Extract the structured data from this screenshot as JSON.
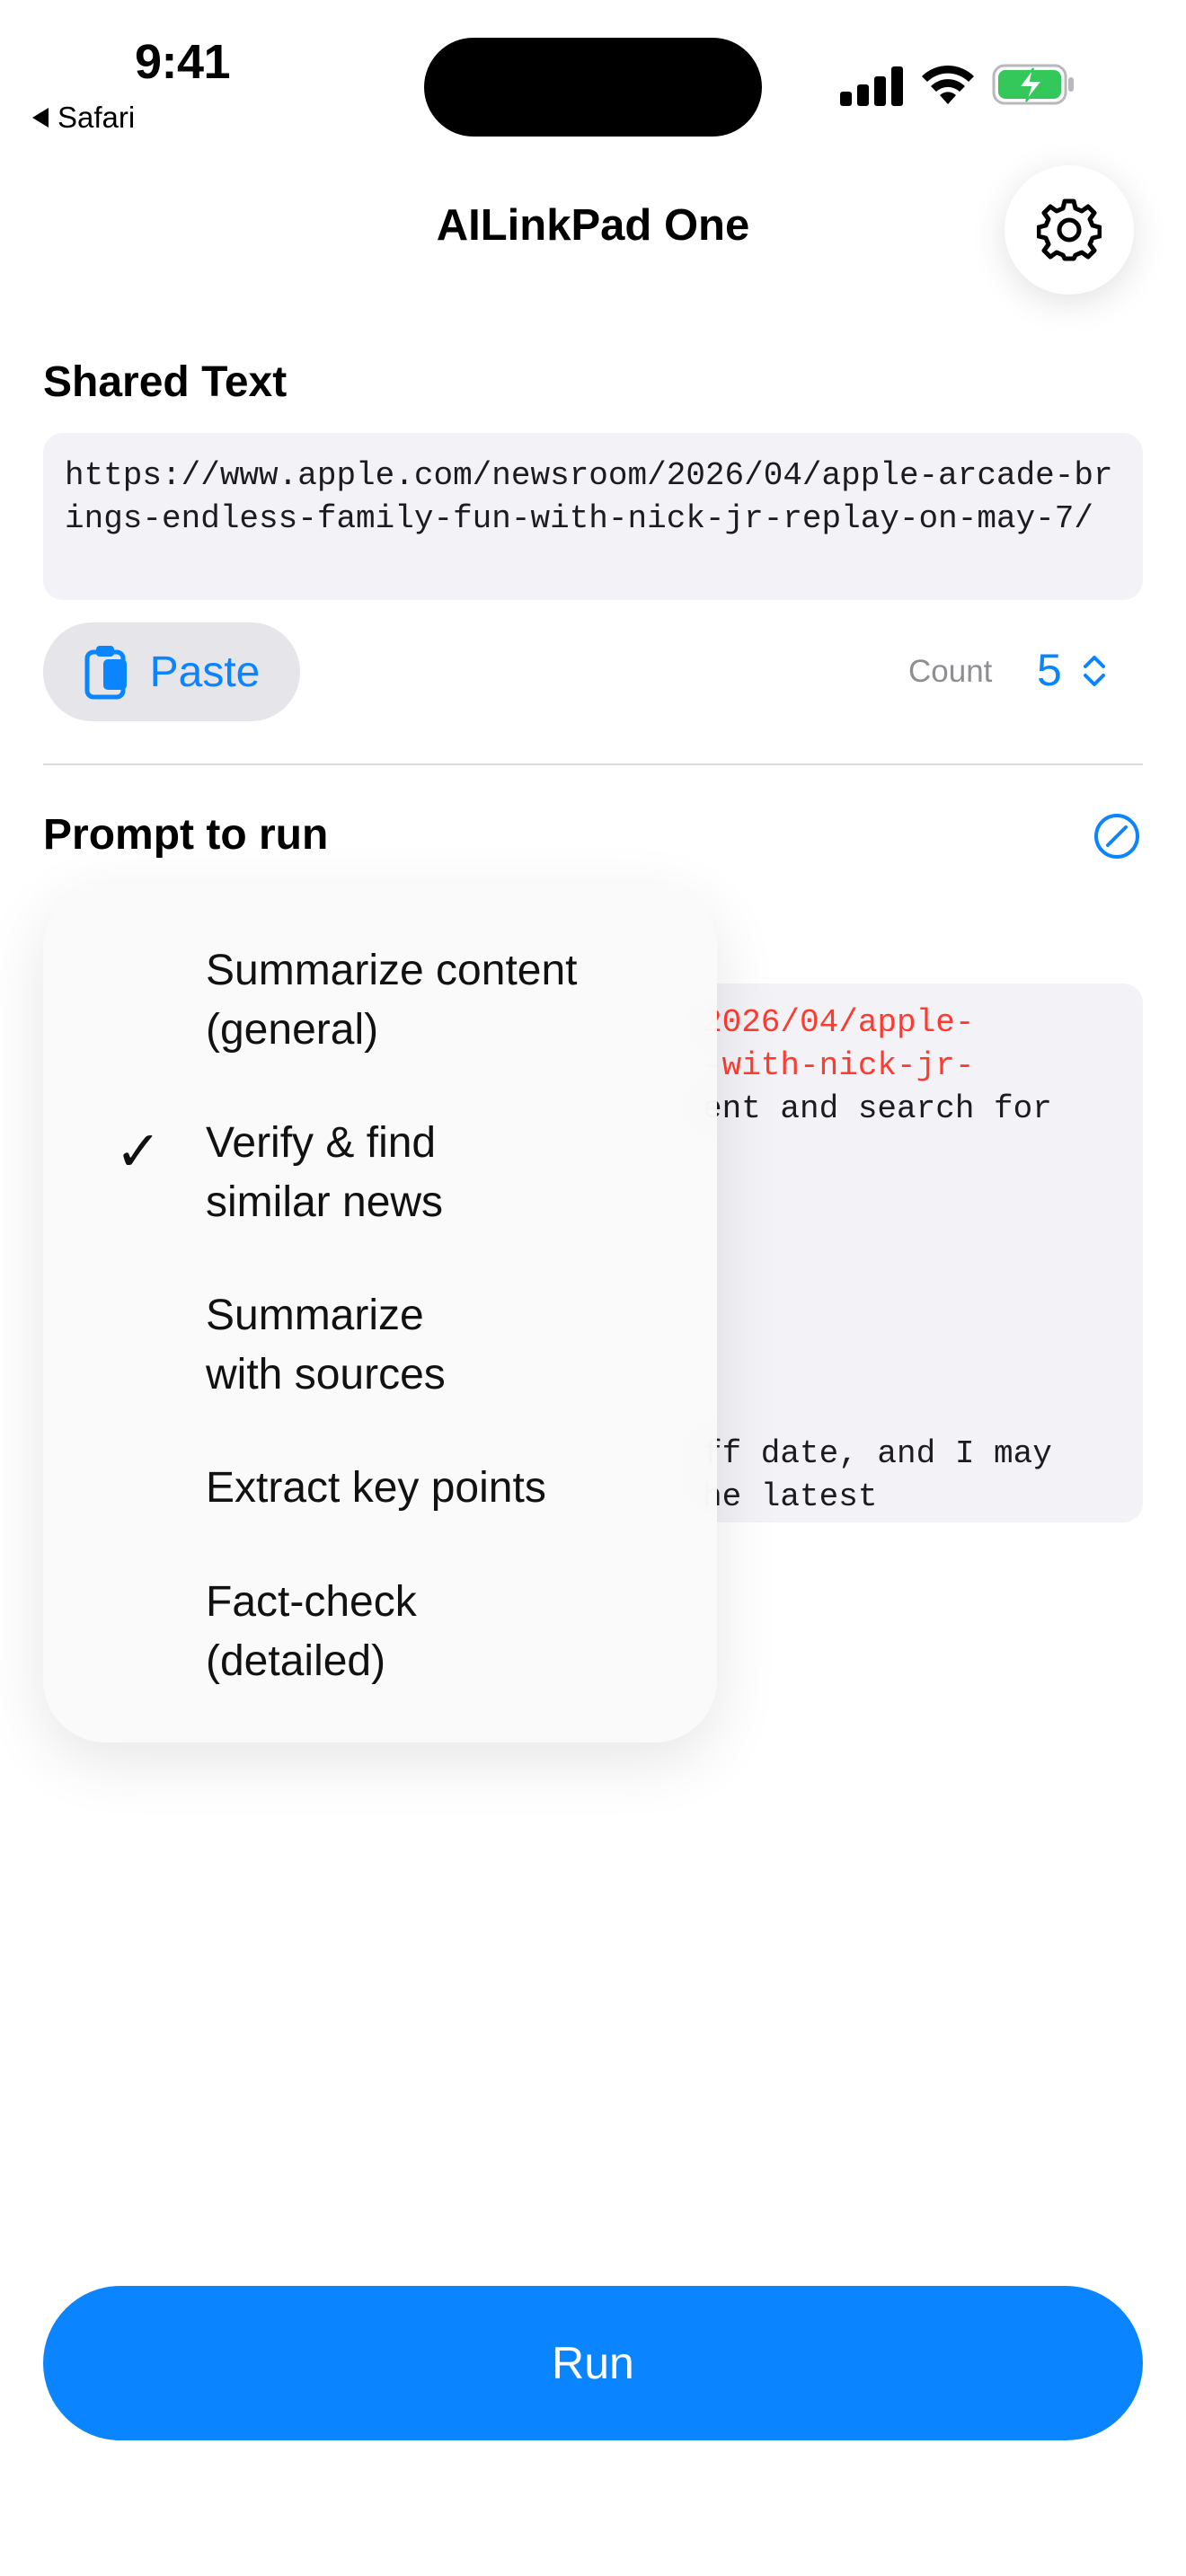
{
  "status_bar": {
    "time": "9:41",
    "back_label": "Safari",
    "battery_color": "#34c759"
  },
  "header": {
    "title": "AILinkPad One",
    "settings_icon": "gear-icon"
  },
  "shared": {
    "label": "Shared Text",
    "text": "https://www.apple.com/newsroom/2026/04/apple-arcade-brings-endless-family-fun-with-nick-jr-replay-on-may-7/",
    "paste_label": "Paste",
    "count_label": "Count",
    "count_value": "5"
  },
  "prompt": {
    "label": "Prompt to run",
    "visible_fragments": {
      "line1": "2026/04/apple-",
      "line2": "-with-nick-jr-",
      "line3": "ent and search for",
      "line4": "ff date, and I may",
      "line5": "he latest"
    }
  },
  "menu": {
    "items": [
      {
        "line1": "Summarize content",
        "line2": "(general)"
      },
      {
        "line1": "Verify & find",
        "line2": "similar news",
        "checked": true
      },
      {
        "line1": "Summarize",
        "line2": "with sources"
      },
      {
        "line1": "Extract key points",
        "line2": ""
      },
      {
        "line1": "Fact-check",
        "line2": "(detailed)"
      }
    ],
    "check_glyph": "✓"
  },
  "actions": {
    "run_label": "Run"
  },
  "colors": {
    "accent": "#0a84ff",
    "url_highlight": "#ff3b30"
  }
}
